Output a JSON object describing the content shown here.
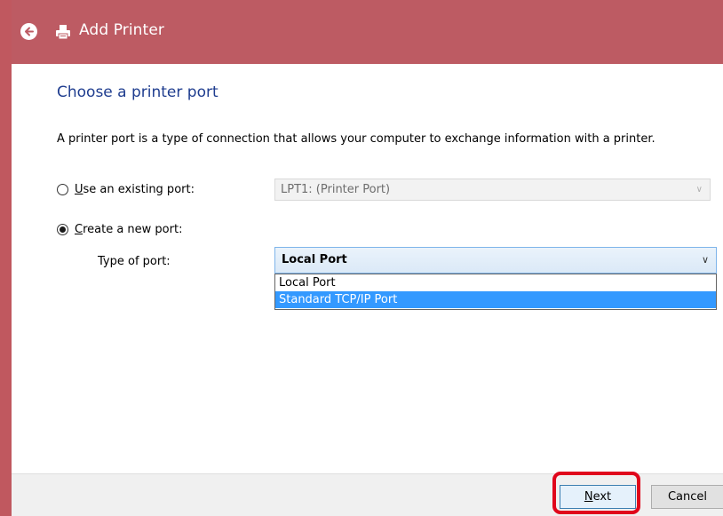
{
  "window": {
    "title": "Add Printer",
    "colors": {
      "titlebar": "#bd5b63",
      "heading": "#1f3d8f",
      "selection": "#3399ff",
      "callout": "#e0061b"
    }
  },
  "icons": {
    "back": "back-arrow-icon",
    "printer": "printer-icon",
    "dropdown": "chevron-down-icon"
  },
  "main": {
    "heading": "Choose a printer port",
    "description": "A printer port is a type of connection that allows your computer to exchange information with a printer.",
    "existing_port": {
      "label_prefix": "",
      "label_accel": "U",
      "label_rest": "se an existing port:",
      "selected": false,
      "value": "LPT1: (Printer Port)"
    },
    "new_port": {
      "label_accel": "C",
      "label_rest": "reate a new port:",
      "selected": true,
      "type_label": "Type of port:",
      "value": "Local Port",
      "options": [
        {
          "label": "Local Port",
          "highlighted": false
        },
        {
          "label": "Standard TCP/IP Port",
          "highlighted": true
        }
      ]
    }
  },
  "footer": {
    "next_accel": "N",
    "next_rest": "ext",
    "cancel_label": "Cancel"
  }
}
